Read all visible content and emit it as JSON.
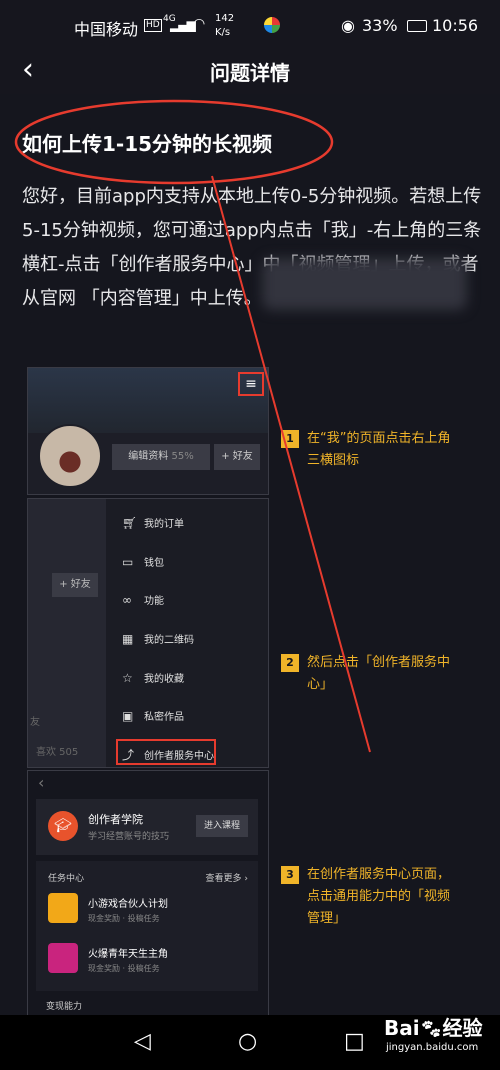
{
  "status_bar": {
    "carrier": "中国移动",
    "hd": "HD",
    "signal": "4G",
    "speed_value": "142",
    "speed_unit": "K/s",
    "battery": "33%",
    "time": "10:56"
  },
  "header": {
    "back_icon": "chevron-left",
    "title": "问题详情"
  },
  "question": {
    "title": "如何上传1-15分钟的长视频",
    "body": "您好，目前app内支持从本地上传0-5分钟视频。若想上传5-15分钟视频，您可通过app内点击「我」-右上角的三条横杠-点击「创作者服务中心」中「视频管理」上传，或者从官网                    「内容管理」中上传。"
  },
  "screenshot1": {
    "edit_profile": "编辑资料",
    "edit_percent": "55%",
    "add_friend": "+ 好友"
  },
  "screenshot2": {
    "left_add_friend": "+ 好友",
    "left_friend_text": "友",
    "left_likes": "喜欢 505",
    "menu": [
      {
        "icon": "cart-icon",
        "label": "我的订单"
      },
      {
        "icon": "wallet-icon",
        "label": "钱包"
      },
      {
        "icon": "link-icon",
        "label": "功能"
      },
      {
        "icon": "qrcode-icon",
        "label": "我的二维码"
      },
      {
        "icon": "star-icon",
        "label": "我的收藏"
      },
      {
        "icon": "image-icon",
        "label": "私密作品"
      },
      {
        "icon": "chart-icon",
        "label": "创作者服务中心"
      }
    ]
  },
  "screenshot3": {
    "academy_title": "创作者学院",
    "academy_sub": "学习经营账号的技巧",
    "academy_button": "进入课程",
    "task_header": "任务中心",
    "task_more": "查看更多",
    "tasks": [
      {
        "title": "小游戏合伙人计划",
        "sub": "现金奖励 · 投稿任务",
        "color": "#f2a818"
      },
      {
        "title": "火爆青年天生主角",
        "sub": "现金奖励 · 投稿任务",
        "color": "#c9247e"
      }
    ],
    "monetize": "变现能力"
  },
  "steps": [
    {
      "num": "1",
      "text": "在“我”的页面点击右上角三横图标"
    },
    {
      "num": "2",
      "text": "然后点击「创作者服务中心」"
    },
    {
      "num": "3",
      "text": "在创作者服务中心页面，点击通用能力中的「视频管理」"
    }
  ],
  "watermark": {
    "brand": "Bai",
    "brand2": "经验",
    "url": "jingyan.baidu.com"
  },
  "colors": {
    "annotation_red": "#e63b2e",
    "step_yellow": "#f0b429",
    "background": "#15161e"
  }
}
